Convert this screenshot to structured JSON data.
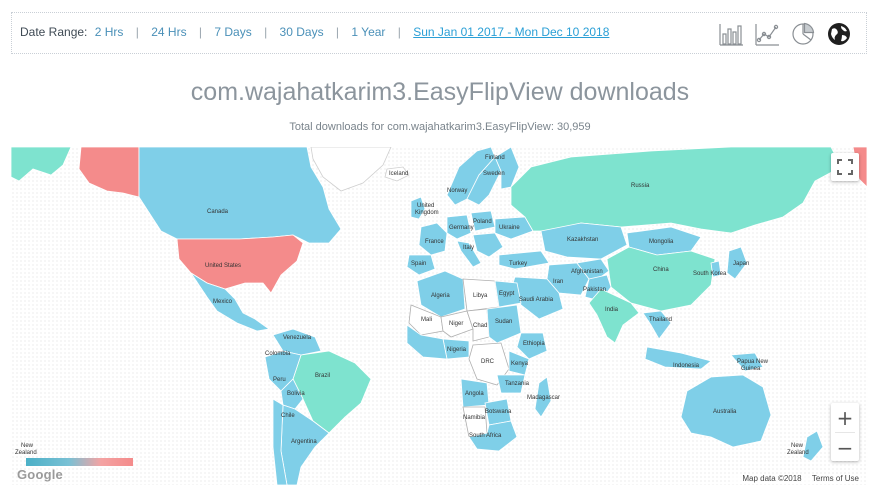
{
  "toolbar": {
    "date_range_label": "Date Range:",
    "options": [
      "2 Hrs",
      "24 Hrs",
      "7 Days",
      "30 Days",
      "1 Year"
    ],
    "custom_range": "Sun Jan 01 2017 - Mon Dec 10 2018",
    "chart_type_icons": [
      "bar-chart-icon",
      "line-chart-icon",
      "pie-chart-icon",
      "globe-icon"
    ]
  },
  "title": "com.wajahatkarim3.EasyFlipView downloads",
  "subtitle": "Total downloads for com.wajahatkarim3.EasyFlipView: 30,959",
  "map": {
    "legend_colors": {
      "low": "#4bb0c7",
      "high": "#f48b8b"
    },
    "colors": {
      "high": "#f48b8b",
      "mid": "#7ee3cf",
      "low": "#7fcfe8",
      "none": "#ffffff"
    },
    "labels": {
      "iceland": "Iceland",
      "finland": "Finland",
      "sweden": "Sweden",
      "norway": "Norway",
      "united_kingdom_1": "United",
      "united_kingdom_2": "Kingdom",
      "germany": "Germany",
      "poland": "Poland",
      "ukraine": "Ukraine",
      "france": "France",
      "italy": "Italy",
      "spain": "Spain",
      "turkey": "Turkey",
      "russia": "Russia",
      "kazakhstan": "Kazakhstan",
      "mongolia": "Mongolia",
      "china": "China",
      "south_korea": "South Korea",
      "japan": "Japan",
      "afghanistan": "Afghanistan",
      "iran": "Iran",
      "pakistan": "Pakistan",
      "india": "India",
      "thailand": "Thailand",
      "saudi_arabia": "Saudi Arabia",
      "egypt": "Egypt",
      "libya": "Libya",
      "algeria": "Algeria",
      "mali": "Mali",
      "niger": "Niger",
      "chad": "Chad",
      "sudan": "Sudan",
      "ethiopia": "Ethiopia",
      "nigeria": "Nigeria",
      "drc": "DRC",
      "kenya": "Kenya",
      "tanzania": "Tanzania",
      "angola": "Angola",
      "namibia": "Namibia",
      "botswana": "Botswana",
      "madagascar": "Madagascar",
      "south_africa": "South Africa",
      "canada": "Canada",
      "united_states": "United States",
      "mexico": "Mexico",
      "venezuela": "Venezuela",
      "colombia": "Colombia",
      "peru": "Peru",
      "brazil": "Brazil",
      "bolivia": "Bolivia",
      "chile": "Chile",
      "argentina": "Argentina",
      "indonesia": "Indonesia",
      "papua_new_guinea_1": "Papua New",
      "papua_new_guinea_2": "Guinea",
      "australia": "Australia",
      "new_zealand_left_1": "New",
      "new_zealand_left_2": "Zealand",
      "new_zealand_right_1": "New",
      "new_zealand_right_2": "Zealand"
    },
    "google_logo": "Google",
    "attribution": {
      "map_data": "Map data ©2018",
      "terms": "Terms of Use"
    },
    "controls": {
      "zoom_in": "+",
      "zoom_out": "−"
    }
  }
}
